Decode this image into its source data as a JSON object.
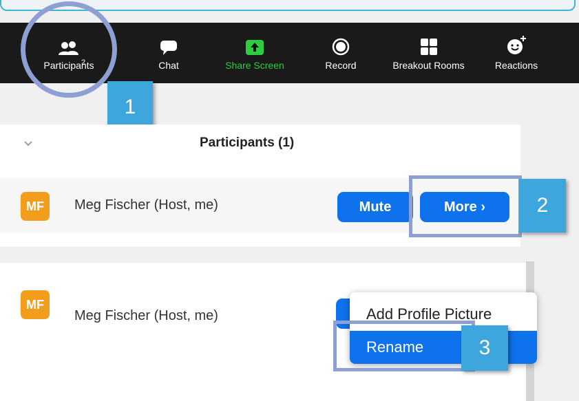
{
  "toolbar": {
    "participants_label": "Participants",
    "participants_count": "2",
    "chat_label": "Chat",
    "share_label": "Share Screen",
    "record_label": "Record",
    "breakout_label": "Breakout Rooms",
    "reactions_label": "Reactions"
  },
  "panel": {
    "title": "Participants (1)",
    "collapse_icon": "chevron-down-icon"
  },
  "participant": {
    "initials": "MF",
    "name": "Meg Fischer (Host, me)",
    "mute_label": "Mute",
    "more_label": "More ›"
  },
  "context_menu": {
    "items": [
      "Add Profile Picture",
      "Rename"
    ],
    "selected": "Rename"
  },
  "steps": [
    "1",
    "2",
    "3"
  ],
  "colors": {
    "accent": "#0e72ed",
    "share_green": "#2ecc40",
    "avatar_orange": "#f29e1c",
    "highlight": "#8e9fd3",
    "step_badge": "#3da6dc"
  }
}
